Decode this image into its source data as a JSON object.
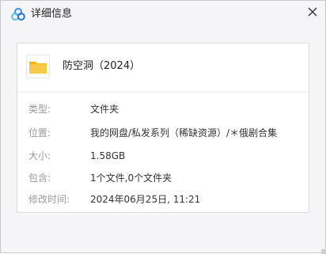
{
  "window": {
    "title": "详细信息",
    "icon": "baidu-netdisk-cloud-icon",
    "close_icon": "close-icon"
  },
  "item": {
    "icon": "folder-icon",
    "name": "防空洞（2024）"
  },
  "details": [
    {
      "label": "类型:",
      "value": "文件夹"
    },
    {
      "label": "位置:",
      "value": "我的网盘/私发系列（稀缺资源）/＊俄剧合集"
    },
    {
      "label": "大小:",
      "value": "1.58GB"
    },
    {
      "label": "包含:",
      "value": "1个文件,0个文件夹"
    },
    {
      "label": "修改时间:",
      "value": "2024年06月25日, 11:21"
    }
  ],
  "colors": {
    "window_bg": "#f5f5f7",
    "folder_yellow": "#f7c948",
    "label_gray": "#999999",
    "text": "#333333"
  }
}
